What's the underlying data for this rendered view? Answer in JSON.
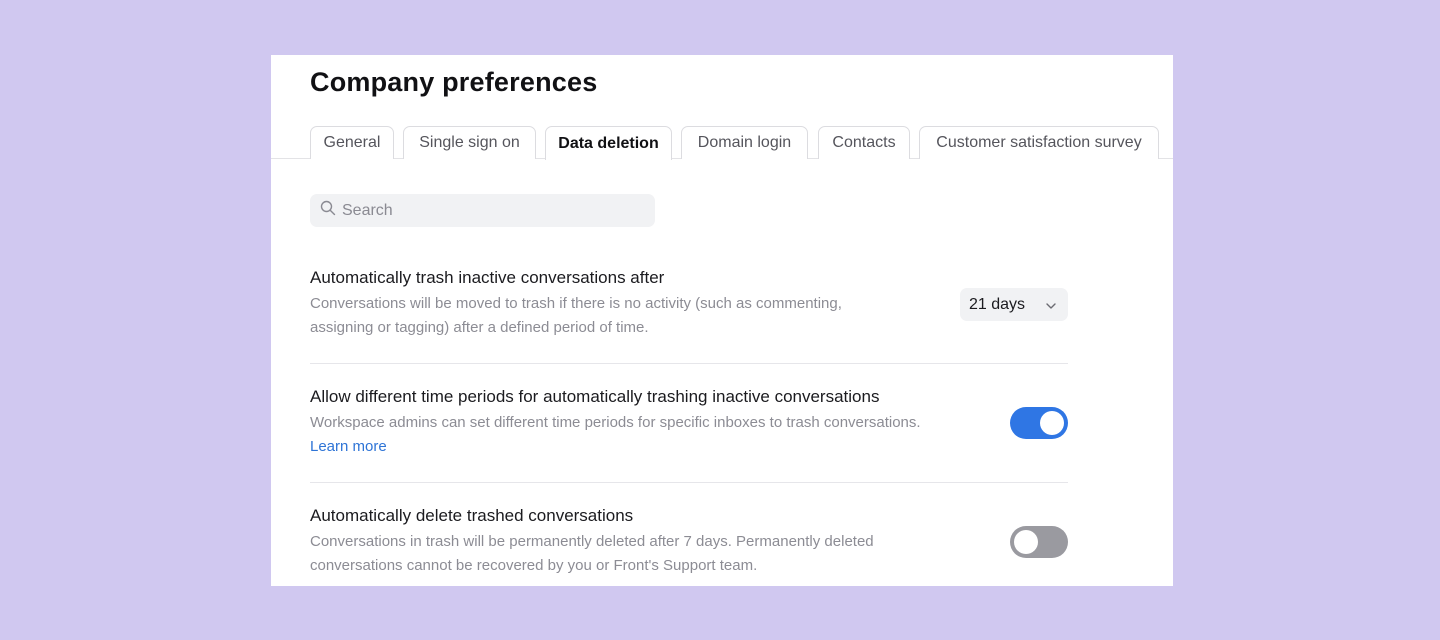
{
  "page": {
    "title": "Company preferences"
  },
  "tabs": [
    {
      "label": "General",
      "active": false
    },
    {
      "label": "Single sign on",
      "active": false
    },
    {
      "label": "Data deletion",
      "active": true
    },
    {
      "label": "Domain login",
      "active": false
    },
    {
      "label": "Contacts",
      "active": false
    },
    {
      "label": "Customer satisfaction survey",
      "active": false
    }
  ],
  "search": {
    "placeholder": "Search",
    "value": ""
  },
  "settings": {
    "trash_inactive": {
      "title": "Automatically trash inactive conversations after",
      "description": "Conversations will be moved to trash if there is no activity (such as commenting, assigning or tagging) after a defined period of time.",
      "selected_value": "21 days"
    },
    "different_periods": {
      "title": "Allow different time periods for automatically trashing inactive conversations",
      "description": "Workspace admins can set different time periods for specific inboxes to trash conversations.",
      "link_label": "Learn more",
      "enabled": true
    },
    "delete_trashed": {
      "title": "Automatically delete trashed conversations",
      "description": "Conversations in trash will be permanently deleted after 7 days. Permanently deleted conversations cannot be recovered by you or Front's Support team.",
      "enabled": false
    }
  },
  "colors": {
    "background": "#d0c8f0",
    "accent": "#2f76e4",
    "toggle_off": "#9a9aa0",
    "link": "#2e74d6"
  }
}
